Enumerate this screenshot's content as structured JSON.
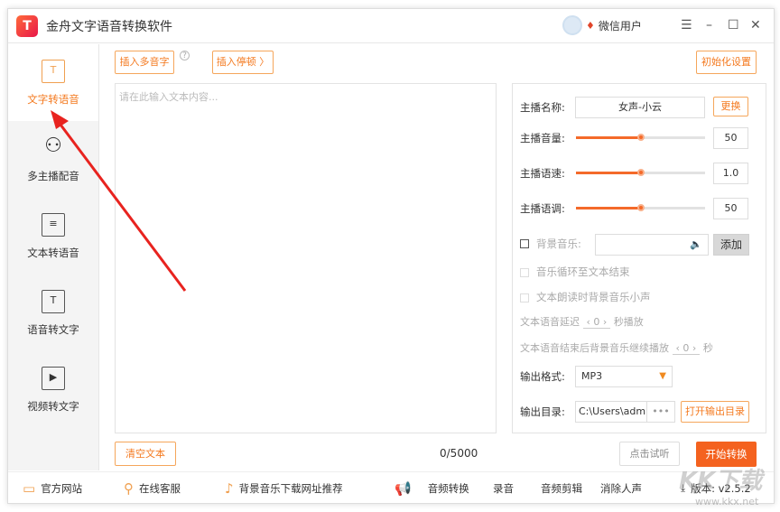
{
  "app": {
    "title": "金舟文字语音转换软件",
    "logo_text": "T",
    "user": "微信用户"
  },
  "window": {
    "menu": "☰",
    "minimize": "–",
    "maximize": "☐",
    "close": "✕"
  },
  "sidebar": {
    "items": [
      {
        "label": "文字转语音",
        "icon": "text-to-speech-icon",
        "glyph": "T"
      },
      {
        "label": "多主播配音",
        "icon": "user-add-icon",
        "glyph": "⚇"
      },
      {
        "label": "文本转语音",
        "icon": "document-icon",
        "glyph": "≡"
      },
      {
        "label": "语音转文字",
        "icon": "speech-to-text-icon",
        "glyph": "T"
      },
      {
        "label": "视频转文字",
        "icon": "video-icon",
        "glyph": "▶"
      }
    ]
  },
  "toolbar": {
    "insert_polyphone": "插入多音字",
    "help": "?",
    "insert_pause": "插入停顿 〉",
    "reset": "初始化设置"
  },
  "editor": {
    "placeholder": "请在此输入文本内容...",
    "count": "0/5000",
    "clear": "清空文本"
  },
  "settings": {
    "anchor_label": "主播名称:",
    "anchor_value": "女声-小云",
    "change": "更换",
    "volume_label": "主播音量:",
    "volume": "50",
    "volume_pct": 50,
    "speed_label": "主播语速:",
    "speed": "1.0",
    "speed_pct": 50,
    "pitch_label": "主播语调:",
    "pitch": "50",
    "pitch_pct": 50,
    "bgm_label": "背景音乐:",
    "add": "添加",
    "loop_label": "音乐循环至文本结束",
    "duck_label": "文本朗读时背景音乐小声",
    "delay_pre": "文本语音延迟",
    "delay_value": "0",
    "delay_post": "秒播放",
    "tail_pre": "文本语音结束后背景音乐继续播放",
    "tail_value": "0",
    "tail_post": "秒",
    "format_label": "输出格式:",
    "format": "MP3",
    "dir_label": "输出目录:",
    "dir": "C:\\Users\\admir",
    "browse": "•••",
    "open_dir": "打开输出目录"
  },
  "actions": {
    "preview": "点击试听",
    "start": "开始转换"
  },
  "footer": {
    "website": "官方网站",
    "service": "在线客服",
    "bgm_download": "背景音乐下载网址推荐",
    "audio_convert": "音频转换",
    "record": "录音",
    "audio_edit": "音频剪辑",
    "vocal_remove": "消除人声",
    "version": "版本: v2.5.2"
  },
  "watermark": {
    "text": "KK下载",
    "url": "www.kkx.net"
  },
  "colors": {
    "accent": "#f47a20",
    "primary_button": "#f4621f",
    "arrow": "#e8231f"
  }
}
